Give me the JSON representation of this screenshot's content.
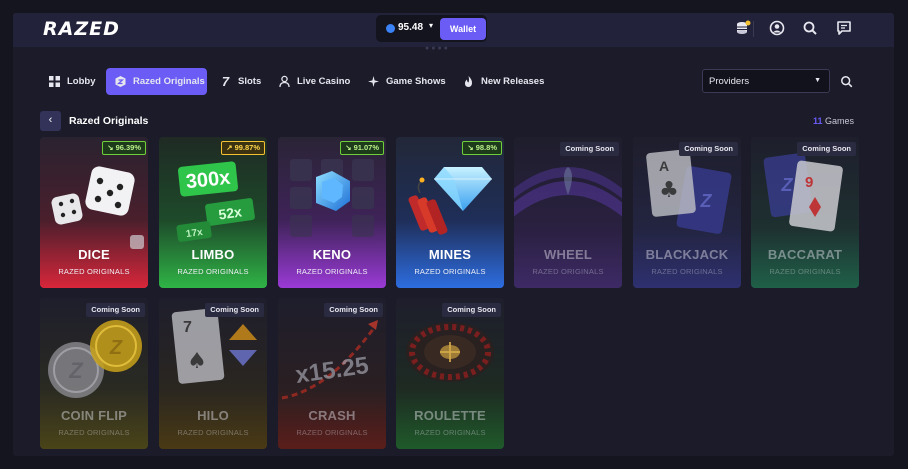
{
  "header": {
    "logo": "RAZED",
    "balance": "95.48",
    "wallet_label": "Wallet",
    "icons": [
      "coins-stack-icon",
      "user-icon",
      "search-icon",
      "chat-icon"
    ]
  },
  "nav": {
    "items": [
      {
        "label": "Lobby",
        "icon": "grid-icon",
        "active": false
      },
      {
        "label": "Razed Originals",
        "icon": "razed-icon",
        "active": true
      },
      {
        "label": "Slots",
        "icon": "seven-icon",
        "active": false
      },
      {
        "label": "Live Casino",
        "icon": "dealer-icon",
        "active": false
      },
      {
        "label": "Game Shows",
        "icon": "sparkle-icon",
        "active": false
      },
      {
        "label": "New Releases",
        "icon": "flame-icon",
        "active": false
      }
    ],
    "providers_label": "Providers"
  },
  "section": {
    "title": "Razed Originals",
    "count": "11",
    "count_label": "Games"
  },
  "colors": {
    "accent": "#6a5cf5",
    "dice": "#d8263a",
    "limbo": "#2fb446",
    "keno": "#9a3ad6",
    "mines": "#2d6de0",
    "wheel": "#6a3ab0",
    "blackjack": "#3b3fa8",
    "baccarat": "#1f8a5a",
    "coinflip": "#c9a21a",
    "hilo": "#c98a1a",
    "crash": "#d83a2a",
    "roulette": "#1f9a3a"
  },
  "games": [
    {
      "name": "DICE",
      "subtitle": "RAZED ORIGINALS",
      "rtp": "96.39%",
      "status": "live"
    },
    {
      "name": "LIMBO",
      "subtitle": "RAZED ORIGINALS",
      "rtp": "99.87%",
      "status": "live",
      "art_text": [
        "300x",
        "52x",
        "17x"
      ]
    },
    {
      "name": "KENO",
      "subtitle": "RAZED ORIGINALS",
      "rtp": "91.07%",
      "status": "live"
    },
    {
      "name": "MINES",
      "subtitle": "RAZED ORIGINALS",
      "rtp": "98.8%",
      "status": "live"
    },
    {
      "name": "WHEEL",
      "subtitle": "RAZED ORIGINALS",
      "badge": "Coming Soon",
      "status": "soon"
    },
    {
      "name": "BLACKJACK",
      "subtitle": "RAZED ORIGINALS",
      "badge": "Coming Soon",
      "status": "soon",
      "art_text": [
        "A",
        "Z"
      ]
    },
    {
      "name": "BACCARAT",
      "subtitle": "RAZED ORIGINALS",
      "badge": "Coming Soon",
      "status": "soon",
      "art_text": [
        "9",
        "Z"
      ]
    },
    {
      "name": "COIN FLIP",
      "subtitle": "RAZED ORIGINALS",
      "badge": "Coming Soon",
      "status": "soon",
      "art_text": [
        "Z",
        "Z"
      ]
    },
    {
      "name": "HILO",
      "subtitle": "RAZED ORIGINALS",
      "badge": "Coming Soon",
      "status": "soon",
      "art_text": [
        "7"
      ]
    },
    {
      "name": "CRASH",
      "subtitle": "RAZED ORIGINALS",
      "badge": "Coming Soon",
      "status": "soon",
      "art_text": [
        "x15.25"
      ]
    },
    {
      "name": "ROULETTE",
      "subtitle": "RAZED ORIGINALS",
      "badge": "Coming Soon",
      "status": "soon"
    }
  ]
}
